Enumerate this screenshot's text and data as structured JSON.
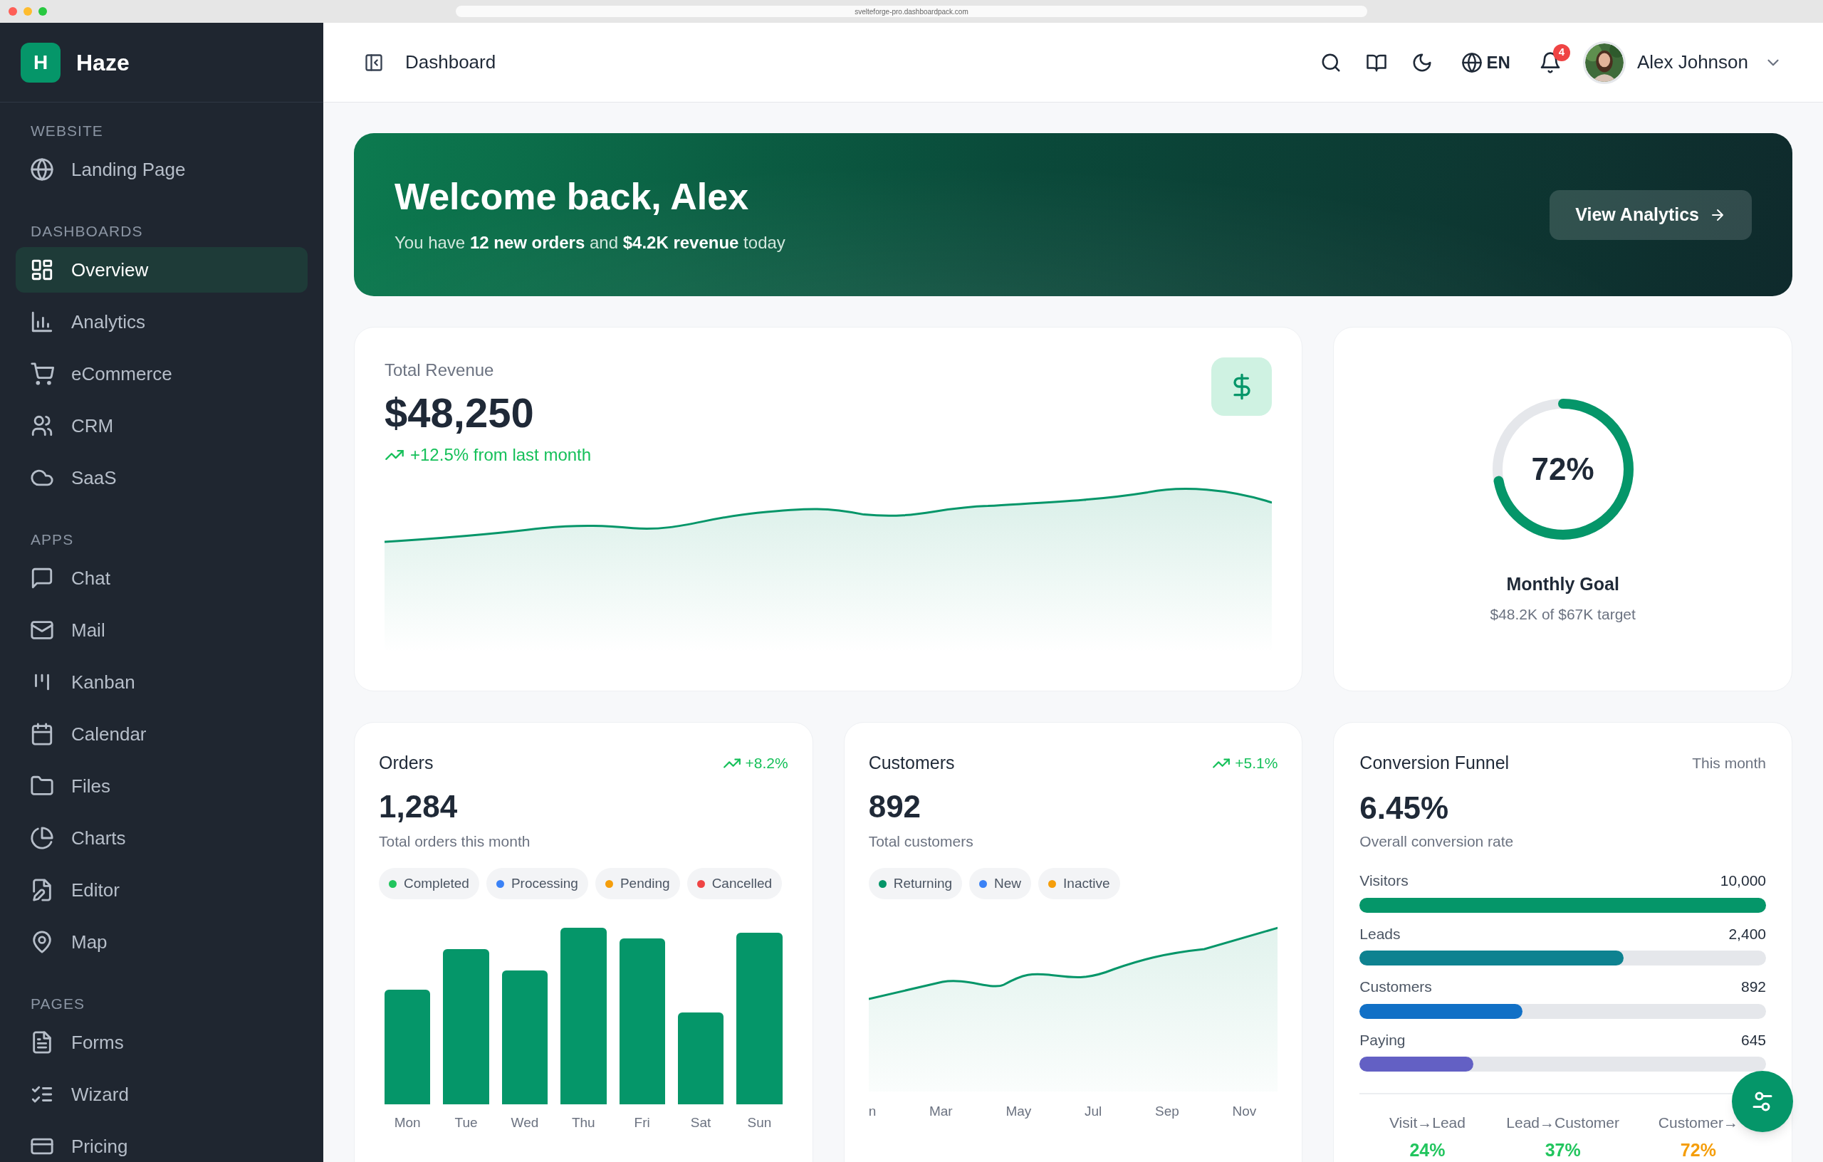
{
  "browser": {
    "url": "svelteforge-pro.dashboardpack.com"
  },
  "sidebar": {
    "logo_letter": "H",
    "brand": "Haze",
    "sections": [
      {
        "heading": "WEBSITE",
        "items": [
          {
            "label": "Landing Page",
            "selected": false
          }
        ]
      },
      {
        "heading": "DASHBOARDS",
        "items": [
          {
            "label": "Overview",
            "selected": true
          },
          {
            "label": "Analytics",
            "selected": false
          },
          {
            "label": "eCommerce",
            "selected": false
          },
          {
            "label": "CRM",
            "selected": false
          },
          {
            "label": "SaaS",
            "selected": false
          }
        ]
      },
      {
        "heading": "APPS",
        "items": [
          {
            "label": "Chat",
            "selected": false
          },
          {
            "label": "Mail",
            "selected": false
          },
          {
            "label": "Kanban",
            "selected": false
          },
          {
            "label": "Calendar",
            "selected": false
          },
          {
            "label": "Files",
            "selected": false
          },
          {
            "label": "Charts",
            "selected": false
          },
          {
            "label": "Editor",
            "selected": false
          },
          {
            "label": "Map",
            "selected": false
          }
        ]
      },
      {
        "heading": "PAGES",
        "items": [
          {
            "label": "Forms",
            "selected": false
          },
          {
            "label": "Wizard",
            "selected": false
          },
          {
            "label": "Pricing",
            "selected": false
          }
        ]
      }
    ]
  },
  "header": {
    "title": "Dashboard",
    "language": "EN",
    "notifications": "4",
    "user": "Alex Johnson"
  },
  "banner": {
    "title": "Welcome back, Alex",
    "subtitle": "You have **12 new orders** and **$4.2K revenue** today",
    "button": "View Analytics"
  },
  "revenue": {
    "label": "Total Revenue",
    "value": "$48,250",
    "change": "+12.5% from last month"
  },
  "goal": {
    "level": 0.72,
    "reading": "72%",
    "title": "Monthly Goal",
    "subtitle": "$48.2K of $67K target"
  },
  "orders": {
    "title": "Orders",
    "change": "+8.2%",
    "value": "1,284",
    "caption": "Total orders this month",
    "tags": [
      {
        "label": "Completed",
        "color": "#22c55e"
      },
      {
        "label": "Processing",
        "color": "#3b82f6"
      },
      {
        "label": "Pending",
        "color": "#f59e0b"
      },
      {
        "label": "Cancelled",
        "color": "#ef4444"
      }
    ],
    "days": [
      "Mon",
      "Tue",
      "Wed",
      "Thu",
      "Fri",
      "Sat",
      "Sun"
    ]
  },
  "customers": {
    "title": "Customers",
    "change": "+5.1%",
    "value": "892",
    "caption": "Total customers",
    "tags": [
      {
        "label": "Returning",
        "color": "#059669"
      },
      {
        "label": "New",
        "color": "#3b82f6"
      },
      {
        "label": "Inactive",
        "color": "#f59e0b"
      }
    ],
    "months": [
      "n",
      "Mar",
      "May",
      "Jul",
      "Sep",
      "Nov"
    ]
  },
  "funnel": {
    "title": "Conversion Funnel",
    "period": "This month",
    "value": "6.45%",
    "caption": "Overall conversion rate",
    "stages": [
      {
        "label": "Visitors",
        "count": "10,000",
        "level": 1,
        "color": "#059669"
      },
      {
        "label": "Leads",
        "count": "2,400",
        "level": 0.65,
        "color": "#0e8290"
      },
      {
        "label": "Customers",
        "count": "892",
        "level": 0.4,
        "color": "#1170c6"
      },
      {
        "label": "Paying",
        "count": "645",
        "level": 0.28,
        "color": "#6360c4"
      }
    ],
    "rates": [
      {
        "label": "Visit→Lead",
        "value": "24%",
        "color": "#22c55e"
      },
      {
        "label": "Lead→Customer",
        "value": "37%",
        "color": "#22c55e"
      },
      {
        "label": "Customer→",
        "value": "72%",
        "color": "#f59e0b"
      }
    ]
  }
}
